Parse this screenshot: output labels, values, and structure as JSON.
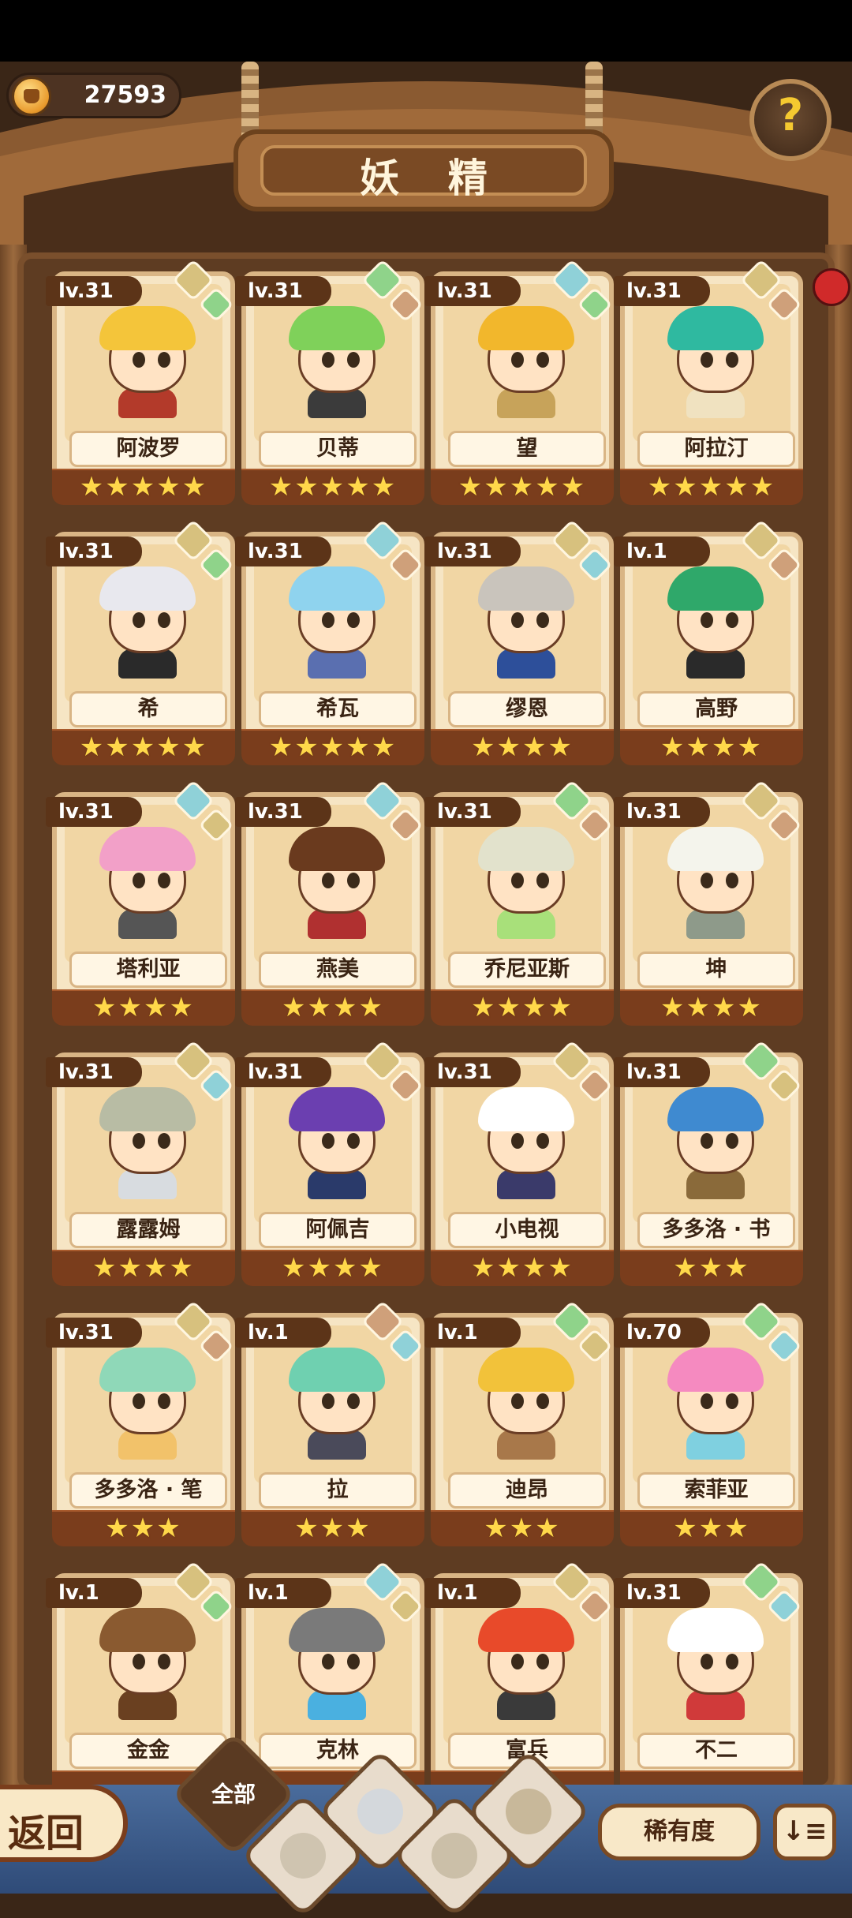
{
  "header": {
    "currency_value": "27593",
    "title": "妖 精",
    "help_label": "?"
  },
  "cards": [
    {
      "level": "lv.31",
      "name": "阿波罗",
      "stars": "★★★★★",
      "hair": "#f4c53a",
      "torso": "#b33a2a",
      "gemA": "#d7c17e",
      "gemB": "#8fd38a"
    },
    {
      "level": "lv.31",
      "name": "贝蒂",
      "stars": "★★★★★",
      "hair": "#7fd15a",
      "torso": "#3b3b3b",
      "gemA": "#8fd38a",
      "gemB": "#cfa07a"
    },
    {
      "level": "lv.31",
      "name": "望",
      "stars": "★★★★★",
      "hair": "#f2b72c",
      "torso": "#c7a35a",
      "gemA": "#8fd1d8",
      "gemB": "#8fd38a"
    },
    {
      "level": "lv.31",
      "name": "阿拉汀",
      "stars": "★★★★★",
      "hair": "#2fb9a0",
      "torso": "#f0e2c0",
      "gemA": "#d7c17e",
      "gemB": "#cfa07a"
    },
    {
      "level": "lv.31",
      "name": "希",
      "stars": "★★★★★",
      "hair": "#e8e8ee",
      "torso": "#2a2a2a",
      "gemA": "#d7c17e",
      "gemB": "#8fd38a"
    },
    {
      "level": "lv.31",
      "name": "希瓦",
      "stars": "★★★★★",
      "hair": "#8fd3ee",
      "torso": "#5a6fb0",
      "gemA": "#8fd1d8",
      "gemB": "#cfa07a"
    },
    {
      "level": "lv.31",
      "name": "缪恩",
      "stars": "★★★★",
      "hair": "#c9c4bc",
      "torso": "#2d4f9a",
      "gemA": "#d7c17e",
      "gemB": "#8fd1d8"
    },
    {
      "level": "lv.1",
      "name": "高野",
      "stars": "★★★★",
      "hair": "#2fa86a",
      "torso": "#2a2a2a",
      "gemA": "#d7c17e",
      "gemB": "#cfa07a"
    },
    {
      "level": "lv.31",
      "name": "塔利亚",
      "stars": "★★★★",
      "hair": "#f2a0c8",
      "torso": "#555555",
      "gemA": "#8fd1d8",
      "gemB": "#d7c17e"
    },
    {
      "level": "lv.31",
      "name": "燕美",
      "stars": "★★★★",
      "hair": "#6a3a1e",
      "torso": "#b03030",
      "gemA": "#8fd1d8",
      "gemB": "#cfa07a"
    },
    {
      "level": "lv.31",
      "name": "乔尼亚斯",
      "stars": "★★★★",
      "hair": "#e2e2cc",
      "torso": "#a8e07a",
      "gemA": "#8fd38a",
      "gemB": "#cfa07a"
    },
    {
      "level": "lv.31",
      "name": "坤",
      "stars": "★★★★",
      "hair": "#f4f4ec",
      "torso": "#8e9a8a",
      "gemA": "#d7c17e",
      "gemB": "#cfa07a"
    },
    {
      "level": "lv.31",
      "name": "露露姆",
      "stars": "★★★★",
      "hair": "#b8bca4",
      "torso": "#d8dce0",
      "gemA": "#d7c17e",
      "gemB": "#8fd1d8"
    },
    {
      "level": "lv.31",
      "name": "阿佩吉",
      "stars": "★★★★",
      "hair": "#6b3fb0",
      "torso": "#2a3a6a",
      "gemA": "#d7c17e",
      "gemB": "#cfa07a"
    },
    {
      "level": "lv.31",
      "name": "小电视",
      "stars": "★★★★",
      "hair": "#ffffff",
      "torso": "#3a3a6a",
      "gemA": "#d7c17e",
      "gemB": "#cfa07a"
    },
    {
      "level": "lv.31",
      "name": "多多洛 · 书",
      "stars": "★★★",
      "hair": "#3f8ad0",
      "torso": "#8a6a3a",
      "gemA": "#8fd38a",
      "gemB": "#d7c17e"
    },
    {
      "level": "lv.31",
      "name": "多多洛 · 笔",
      "stars": "★★★",
      "hair": "#8fd8b8",
      "torso": "#f2c26a",
      "gemA": "#d7c17e",
      "gemB": "#cfa07a"
    },
    {
      "level": "lv.1",
      "name": "拉",
      "stars": "★★★",
      "hair": "#6fd0b0",
      "torso": "#4a4a5a",
      "gemA": "#cfa07a",
      "gemB": "#8fd1d8"
    },
    {
      "level": "lv.1",
      "name": "迪昂",
      "stars": "★★★",
      "hair": "#f2c23a",
      "torso": "#a8784a",
      "gemA": "#8fd38a",
      "gemB": "#d7c17e"
    },
    {
      "level": "lv.70",
      "name": "索菲亚",
      "stars": "★★★",
      "hair": "#f58ac0",
      "torso": "#7fd0e0",
      "gemA": "#8fd38a",
      "gemB": "#8fd1d8"
    },
    {
      "level": "lv.1",
      "name": "金金",
      "stars": "",
      "hair": "#8a5a30",
      "torso": "#6a4020",
      "gemA": "#d7c17e",
      "gemB": "#8fd38a"
    },
    {
      "level": "lv.1",
      "name": "克林",
      "stars": "",
      "hair": "#7a7a7a",
      "torso": "#4ab0e0",
      "gemA": "#8fd1d8",
      "gemB": "#d7c17e"
    },
    {
      "level": "lv.1",
      "name": "富兵",
      "stars": "",
      "hair": "#e84a2a",
      "torso": "#3a3a3a",
      "gemA": "#d7c17e",
      "gemB": "#cfa07a"
    },
    {
      "level": "lv.31",
      "name": "不二",
      "stars": "",
      "hair": "#ffffff",
      "torso": "#d03a3a",
      "gemA": "#8fd38a",
      "gemB": "#8fd1d8"
    }
  ],
  "bottom": {
    "back_label": "返回",
    "filter_all_label": "全部",
    "rarity_label": "稀有度",
    "sort_label": "↓≡"
  },
  "colors": {
    "wood_dark": "#5e3c22",
    "card_bg": "#f6e5c4",
    "star": "#ffd84a",
    "bottom_blue": "#3a5a8c"
  }
}
